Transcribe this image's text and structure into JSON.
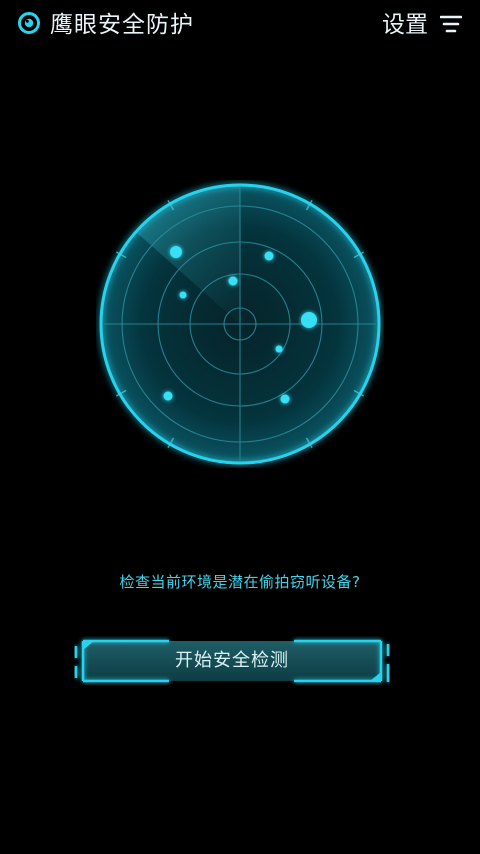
{
  "header": {
    "title": "鹰眼安全防护",
    "settings_label": "设置"
  },
  "main": {
    "prompt": "检查当前环境是潜在偷拍窃听设备?",
    "scan_button_label": "开始安全检测"
  },
  "icons": {
    "logo": "eye-logo-icon",
    "menu": "menu-lines-icon"
  },
  "colors": {
    "background": "#000000",
    "accent": "#27d3ee",
    "text": "#e8f4f7"
  }
}
